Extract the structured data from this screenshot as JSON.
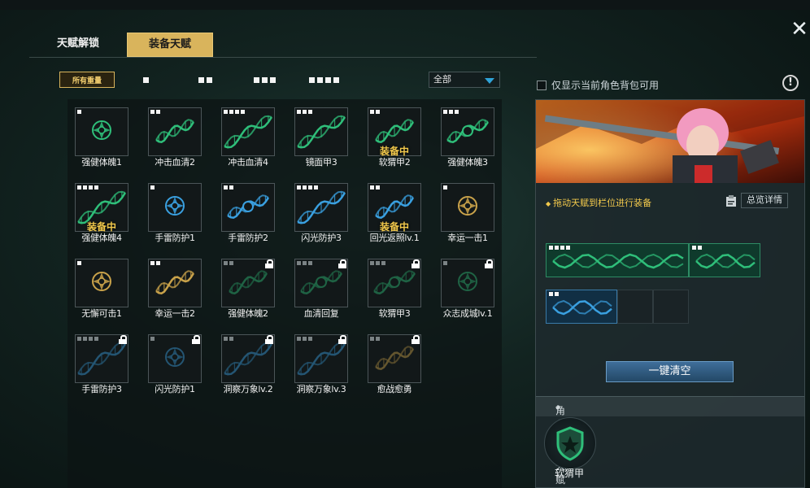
{
  "tabs": {
    "unlock": "天赋解锁",
    "equip": "装备天赋"
  },
  "filters": {
    "all_weight": "所有重量",
    "levels": [
      1,
      2,
      3,
      4
    ]
  },
  "dropdown": {
    "selected": "全部"
  },
  "show_only_label": "仅显示当前角色背包可用",
  "help_symbol": "!",
  "equipped_label": "装备中",
  "talents": [
    {
      "name": "强健体魄1",
      "lvl": 1,
      "icon": "green-emblem",
      "equipped": false,
      "locked": false
    },
    {
      "name": "冲击血清2",
      "lvl": 2,
      "icon": "green-dna",
      "equipped": false,
      "locked": false
    },
    {
      "name": "冲击血清4",
      "lvl": 4,
      "icon": "green-dna-long",
      "equipped": false,
      "locked": false
    },
    {
      "name": "镜面甲3",
      "lvl": 3,
      "icon": "green-dna-long",
      "equipped": false,
      "locked": false
    },
    {
      "name": "软猬甲2",
      "lvl": 2,
      "icon": "green-dna",
      "equipped": true,
      "locked": false
    },
    {
      "name": "强健体魄3",
      "lvl": 3,
      "icon": "green-dna-emblem",
      "equipped": false,
      "locked": false
    },
    {
      "name": "强健体魄4",
      "lvl": 4,
      "icon": "green-dna-long",
      "equipped": true,
      "locked": false
    },
    {
      "name": "手雷防护1",
      "lvl": 1,
      "icon": "blue-emblem",
      "equipped": false,
      "locked": false
    },
    {
      "name": "手雷防护2",
      "lvl": 2,
      "icon": "blue-dna-emblem",
      "equipped": false,
      "locked": false
    },
    {
      "name": "闪光防护3",
      "lvl": 4,
      "icon": "blue-dna-long",
      "equipped": false,
      "locked": false
    },
    {
      "name": "回光返照lv.1",
      "lvl": 2,
      "icon": "blue-dna",
      "equipped": true,
      "locked": false
    },
    {
      "name": "幸运一击1",
      "lvl": 1,
      "icon": "gold-emblem",
      "equipped": false,
      "locked": false
    },
    {
      "name": "无懈可击1",
      "lvl": 1,
      "icon": "gold-emblem",
      "equipped": false,
      "locked": false
    },
    {
      "name": "幸运一击2",
      "lvl": 2,
      "icon": "gold-dna",
      "equipped": false,
      "locked": false
    },
    {
      "name": "强健体魄2",
      "lvl": 2,
      "icon": "green-dna",
      "equipped": false,
      "locked": true
    },
    {
      "name": "血清回复",
      "lvl": 3,
      "icon": "green-dna-emblem",
      "equipped": false,
      "locked": true
    },
    {
      "name": "软猬甲3",
      "lvl": 3,
      "icon": "green-dna-emblem",
      "equipped": false,
      "locked": true
    },
    {
      "name": "众志成城lv.1",
      "lvl": 1,
      "icon": "green-emblem",
      "equipped": false,
      "locked": true
    },
    {
      "name": "手雷防护3",
      "lvl": 4,
      "icon": "blue-dna-long",
      "equipped": false,
      "locked": true
    },
    {
      "name": "闪光防护1",
      "lvl": 1,
      "icon": "blue-emblem",
      "equipped": false,
      "locked": true
    },
    {
      "name": "洞察万象lv.2",
      "lvl": 2,
      "icon": "blue-dna-long",
      "equipped": false,
      "locked": true
    },
    {
      "name": "洞察万象lv.3",
      "lvl": 3,
      "icon": "blue-dna-long",
      "equipped": false,
      "locked": true
    },
    {
      "name": "愈战愈勇",
      "lvl": 2,
      "icon": "gold-dna",
      "equipped": false,
      "locked": true
    }
  ],
  "right_panel": {
    "drag_hint": "拖动天赋到栏位进行装备",
    "overview_label": "总览详情",
    "clear_all": "一键清空",
    "innate_header": "角色固有天赋",
    "innate_name": "软猬甲",
    "slots": [
      {
        "color": "green",
        "lvl": 4
      },
      {
        "color": "green",
        "lvl": 2
      },
      {
        "color": "blue",
        "lvl": 2
      },
      {
        "color": "empty",
        "lvl": 0
      },
      {
        "color": "empty",
        "lvl": 0
      }
    ]
  },
  "colors": {
    "accent_gold": "#d9b45c",
    "equip_text": "#f2c94c",
    "green": "#2fbf7a",
    "blue": "#3aa0e0",
    "gold": "#c9a24a"
  }
}
